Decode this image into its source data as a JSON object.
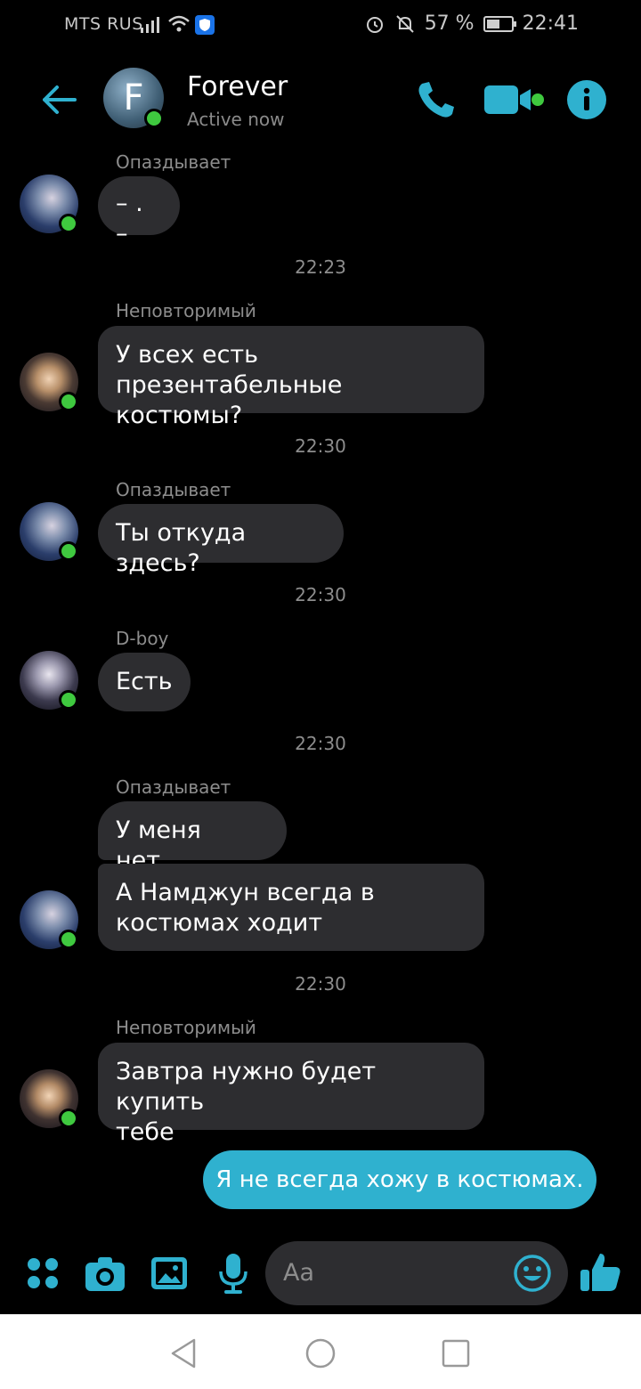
{
  "status_bar": {
    "carrier": "MTS RUS",
    "battery": "57 %",
    "battery_level": 0.57,
    "time": "22:41"
  },
  "header": {
    "back_icon": "arrow-left-icon",
    "avatar_letter": "F",
    "title": "Forever",
    "subtitle": "Active now",
    "call_icon": "phone-icon",
    "video_icon": "video-camera-icon",
    "info_icon": "info-icon"
  },
  "messages": [
    {
      "sender": "Опаздывает",
      "text": "– . –"
    },
    {
      "time": "22:23"
    },
    {
      "sender": "Неповторимый",
      "text_lines": [
        "У всех есть презентабельные",
        "костюмы?"
      ]
    },
    {
      "time": "22:30"
    },
    {
      "sender": "Опаздывает",
      "text": "Ты откуда здесь?"
    },
    {
      "time": "22:30"
    },
    {
      "sender": "D-boy",
      "text": "Есть"
    },
    {
      "time": "22:30"
    },
    {
      "sender": "Опаздывает",
      "text": "У меня нет...",
      "text2_lines": [
        "А Намджун всегда в",
        "костюмах ходит"
      ]
    },
    {
      "time": "22:30"
    },
    {
      "sender": "Неповторимый",
      "text_lines": [
        "Завтра нужно будет купить",
        "тебе"
      ]
    }
  ],
  "my_message": "Я не всегда хожу в костюмах.",
  "composer": {
    "placeholder": "Aa",
    "icons": [
      "apps-icon",
      "camera-icon",
      "gallery-icon",
      "microphone-icon",
      "emoji-icon",
      "thumbs-up-icon"
    ]
  },
  "colors": {
    "accent": "#2fb1cf",
    "bubble": "#2d2d30",
    "online": "#3fc93f",
    "background": "#000000"
  }
}
